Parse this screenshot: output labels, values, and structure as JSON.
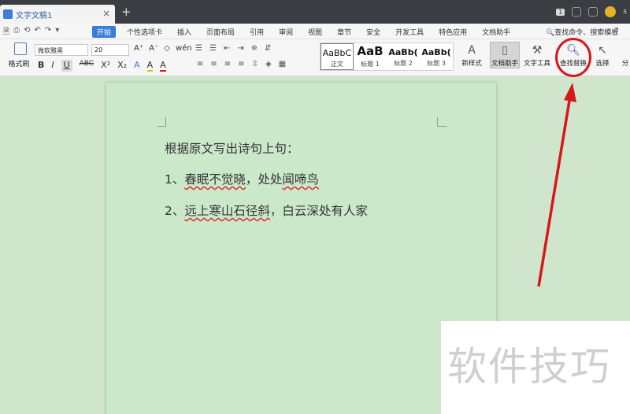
{
  "titlebar": {
    "tab_title": "文字文稿1",
    "tab_close": "×",
    "new_tab": "+",
    "badge": "1",
    "user": "s"
  },
  "menubar": {
    "quick_access": [
      "🗎",
      "⎙",
      "⟲",
      "↶",
      "↷",
      "▾"
    ],
    "items": [
      "开始",
      "个性选项卡",
      "插入",
      "页面布局",
      "引用",
      "审阅",
      "视图",
      "章节",
      "安全",
      "开发工具",
      "特色应用",
      "文档助手"
    ],
    "search_cmd": "查找命令、搜索模板",
    "help": "?"
  },
  "ribbon": {
    "format_painter": "格式刷",
    "font_name": "微软雅黑",
    "font_size": "20",
    "row1_tools": [
      "A⁺",
      "A⁻",
      "◇",
      "wén"
    ],
    "row2_tools": [
      "B",
      "I",
      "U",
      "ABC",
      "X²",
      "X₂",
      "A",
      "A",
      "A"
    ],
    "para_row1": [
      "☰",
      "☰",
      "⇤",
      "⇥",
      "※",
      "⇵"
    ],
    "para_row2": [
      "≡",
      "≡",
      "≡",
      "≡",
      "⇳",
      "◈",
      "▦"
    ],
    "styles": [
      {
        "sample": "AaBbC",
        "name": "正文"
      },
      {
        "sample": "AaB",
        "name": "标题 1"
      },
      {
        "sample": "AaBb(",
        "name": "标题 2"
      },
      {
        "sample": "AaBb(",
        "name": "标题 3"
      }
    ],
    "new_style": "新样式",
    "doc_assistant": "文档助手",
    "text_tools": "文字工具",
    "find_replace": "查找替换",
    "select": "选择",
    "divide": "分"
  },
  "document": {
    "line1": "根据原文写出诗句上句：",
    "line2_prefix": "1、",
    "line2_marked": "春眠不觉晓",
    "line2_mid": "，处处",
    "line2_marked2": "闻啼鸟",
    "line3_prefix": "2、",
    "line3_marked": "远上寒山石径斜",
    "line3_rest": "，白云深处有人家"
  },
  "watermark": "软件技巧",
  "colors": {
    "accent": "#3a7dd8",
    "highlight": "#d8171b",
    "page": "#cce8cb"
  }
}
